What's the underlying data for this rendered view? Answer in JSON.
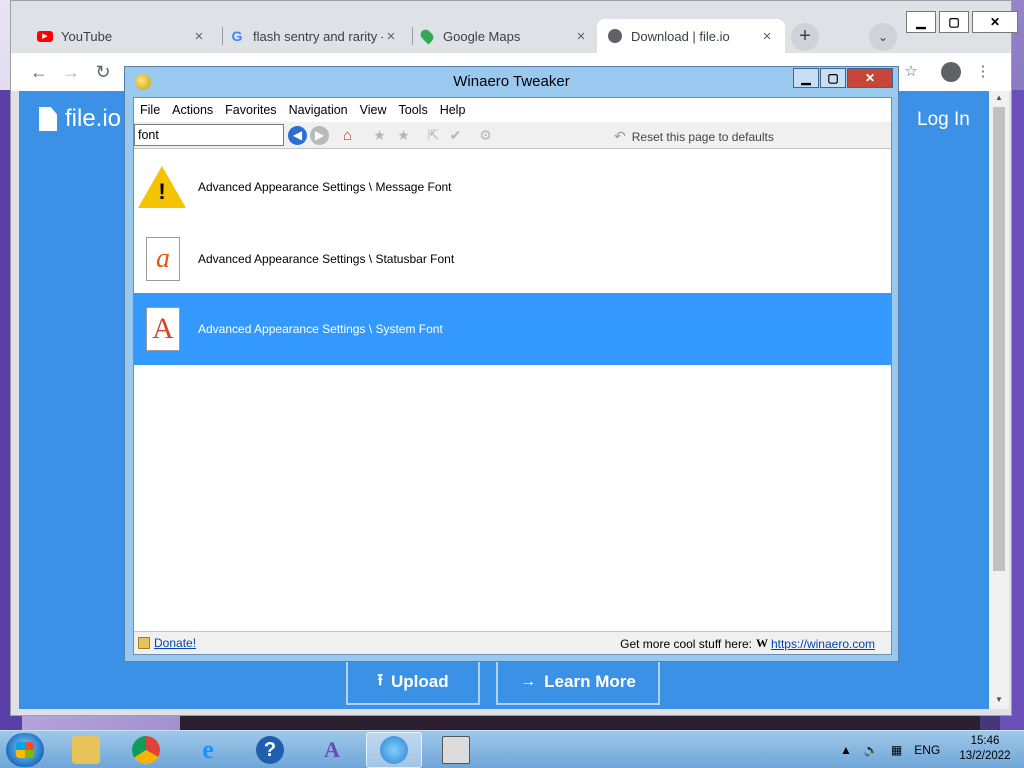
{
  "browser": {
    "tabs": [
      {
        "label": "YouTube",
        "icon": "youtube-icon"
      },
      {
        "label": "flash sentry and rarity -",
        "icon": "google-icon"
      },
      {
        "label": "Google Maps",
        "icon": "maps-icon"
      },
      {
        "label": "Download | file.io",
        "icon": "globe-icon"
      }
    ],
    "new_tab": "+",
    "window_buttons": {
      "minimize": "▁",
      "maximize": "▢",
      "close": "✕"
    }
  },
  "page": {
    "logo": "file.io",
    "login": "Log In",
    "upload_button": "Upload",
    "learn_more_button": "Learn More"
  },
  "tweaker": {
    "title": "Winaero Tweaker",
    "menu": [
      "File",
      "Actions",
      "Favorites",
      "Navigation",
      "View",
      "Tools",
      "Help"
    ],
    "search_value": "font",
    "reset_label": "Reset this page to defaults",
    "results": [
      {
        "label": "Advanced Appearance Settings \\ Message Font",
        "icon": "warning-icon"
      },
      {
        "label": "Advanced Appearance Settings \\ Statusbar Font",
        "icon": "font-italic-a-icon"
      },
      {
        "label": "Advanced Appearance Settings \\ System Font",
        "icon": "font-a-icon"
      }
    ],
    "selected_index": 2,
    "donate": "Donate!",
    "more_text": "Get more cool stuff here:",
    "winaero_logo": "W",
    "more_link": "https://winaero.com"
  },
  "taskbar": {
    "tray_lang": "ENG",
    "time": "15:46",
    "date": "13/2/2022"
  },
  "colors": {
    "page_blue": "#3a91e6",
    "selection_blue": "#3399ff",
    "tweaker_frame": "#99c9ef"
  }
}
